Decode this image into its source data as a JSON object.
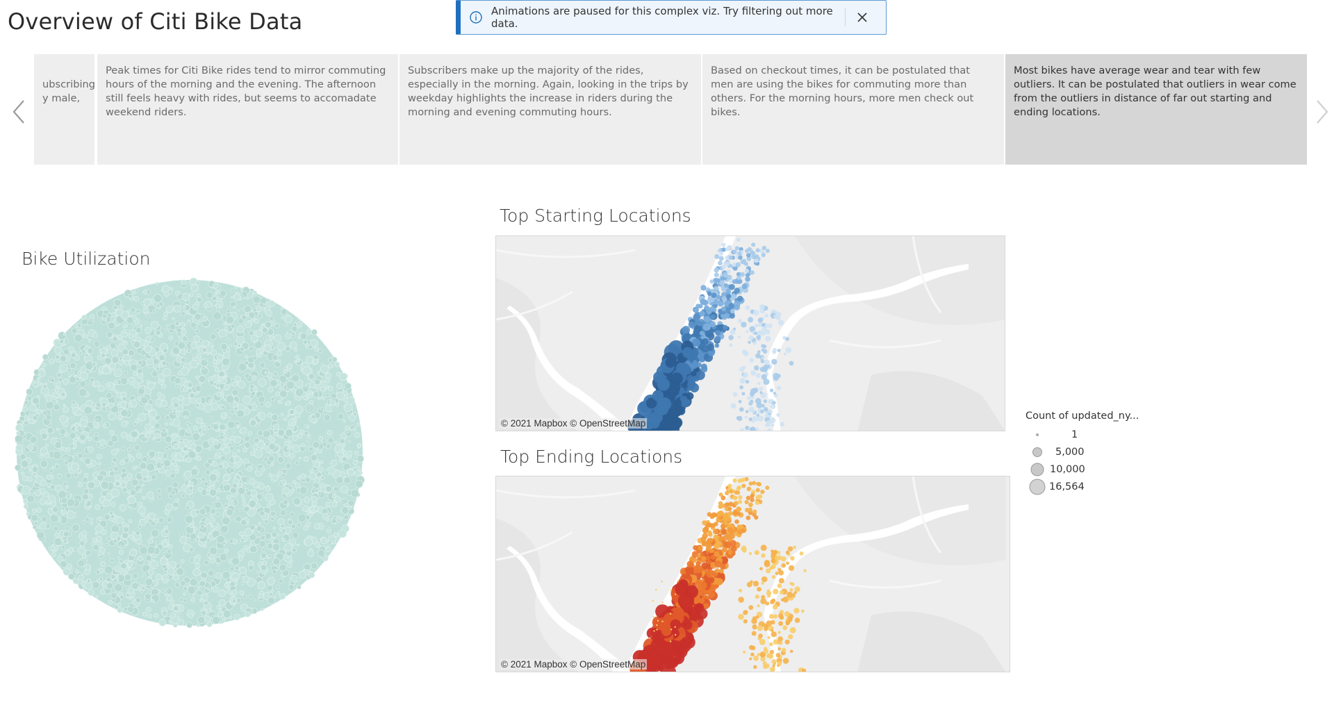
{
  "page": {
    "title": "Overview of Citi Bike Data"
  },
  "notification": {
    "message": "Animations are paused for this complex viz. Try filtering out more data.",
    "icon": "info-icon",
    "close_icon": "close-icon"
  },
  "story": {
    "prev_icon": "chevron-left-icon",
    "next_icon": "chevron-right-icon",
    "points": [
      {
        "text": "ubscribing\ny male,"
      },
      {
        "text": "Peak times for Citi Bike rides tend to mirror commuting hours of the morning and the evening. The afternoon still feels heavy with rides, but seems to accomadate weekend riders."
      },
      {
        "text": "Subscribers make up the majority of the rides, especially in the morning. Again, looking in the trips by weekday highlights the increase in riders during the morning and evening commuting hours."
      },
      {
        "text": "Based on checkout times, it can be postulated that men are using the bikes for commuting more than others. For the morning hours, more men check out bikes."
      },
      {
        "text": "Most bikes have average wear and tear with few outliers. It can be postulated that outliers in wear come from the outliers in distance of far out starting and ending locations.",
        "active": true
      }
    ]
  },
  "bike_utilization": {
    "title": "Bike Utilization",
    "color": "#bfe0da"
  },
  "top_starting": {
    "title": "Top Starting Locations",
    "credit": "© 2021 Mapbox  © OpenStreetMap",
    "palette": [
      "#cfe2f3",
      "#a9cbe9",
      "#7fb0dd",
      "#5b93c9",
      "#3f77b0",
      "#2b5d92"
    ]
  },
  "top_ending": {
    "title": "Top Ending Locations",
    "credit": "© 2021 Mapbox  © OpenStreetMap",
    "palette": [
      "#f8cc6a",
      "#f5b14a",
      "#f29a3c",
      "#ec7a30",
      "#e05a2a",
      "#c9302a"
    ]
  },
  "legend": {
    "title": "Count of updated_ny...",
    "items": [
      {
        "label": "1"
      },
      {
        "label": "5,000"
      },
      {
        "label": "10,000"
      },
      {
        "label": "16,564"
      }
    ]
  }
}
